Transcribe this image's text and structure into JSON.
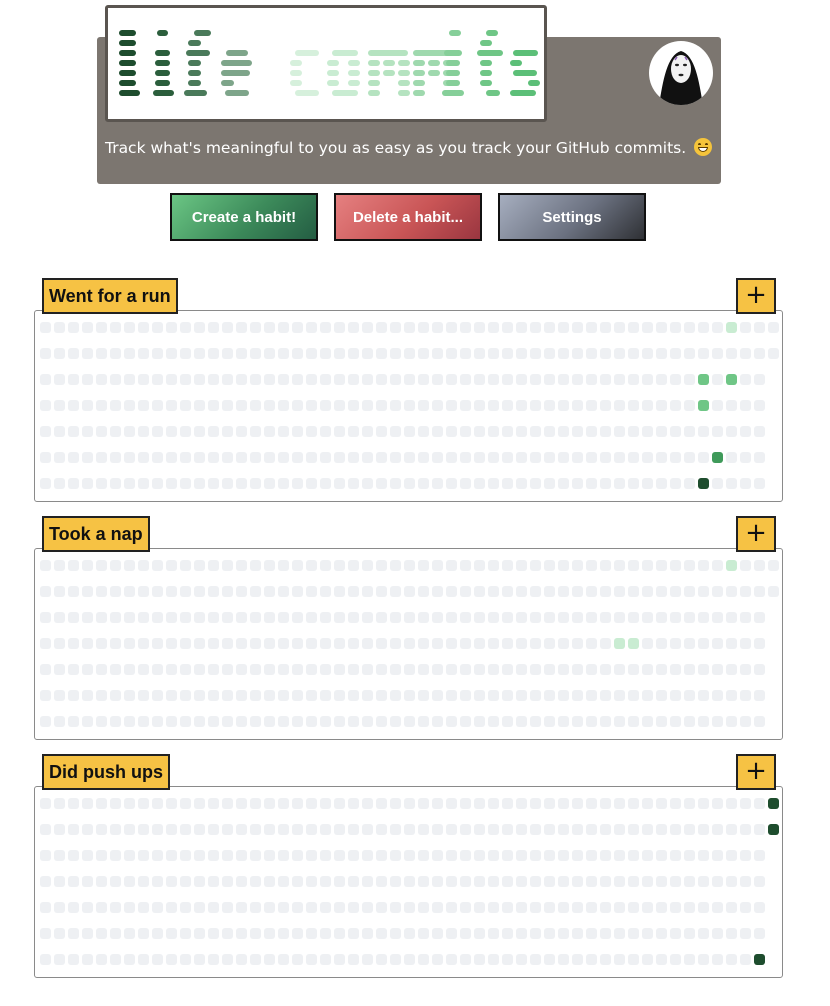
{
  "header": {
    "logo_text": "life commits",
    "tagline": "Track what's meaningful to you as easy as you track your GitHub commits.",
    "emoji": "grinning-face-emoji",
    "avatar": "no-face-avatar"
  },
  "actions": {
    "create_label": "Create a habit!",
    "delete_label": "Delete a habit...",
    "settings_label": "Settings"
  },
  "colors": {
    "banner": "#7c7670",
    "empty_cell": "#eef0f3",
    "level_1": "#c9ecd2",
    "level_2": "#6fc686",
    "level_3": "#3f9a5a",
    "level_4": "#1e4d2e",
    "title_bg": "#f6c244"
  },
  "habits": [
    {
      "title": "Went for a run",
      "add_label": "+",
      "weeks": 53,
      "days": 7,
      "entries": [
        {
          "week": 49,
          "day": 0,
          "level": 1
        },
        {
          "week": 47,
          "day": 2,
          "level": 2
        },
        {
          "week": 49,
          "day": 2,
          "level": 2
        },
        {
          "week": 47,
          "day": 3,
          "level": 2
        },
        {
          "week": 48,
          "day": 5,
          "level": 3
        },
        {
          "week": 47,
          "day": 6,
          "level": 4
        }
      ]
    },
    {
      "title": "Took a nap",
      "add_label": "+",
      "weeks": 53,
      "days": 7,
      "entries": [
        {
          "week": 49,
          "day": 0,
          "level": 1
        },
        {
          "week": 41,
          "day": 3,
          "level": 1
        },
        {
          "week": 42,
          "day": 3,
          "level": 1
        }
      ]
    },
    {
      "title": "Did push ups",
      "add_label": "+",
      "weeks": 53,
      "days": 7,
      "entries": [
        {
          "week": 52,
          "day": 0,
          "level": 4
        },
        {
          "week": 52,
          "day": 1,
          "level": 4
        },
        {
          "week": 51,
          "day": 6,
          "level": 4
        }
      ]
    }
  ]
}
